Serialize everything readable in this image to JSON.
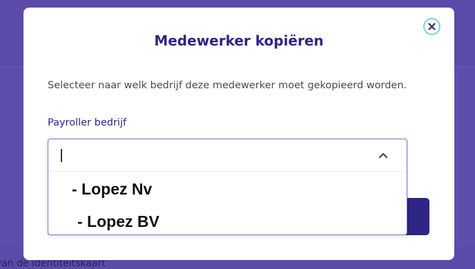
{
  "background": {
    "partial_text": "van de identiteitskaart"
  },
  "modal": {
    "title": "Medewerker kopiëren",
    "description": "Selecteer naar welk bedrijf deze medewerker moet gekopieerd worden.",
    "close_icon": "close-icon",
    "field": {
      "label": "Payroller bedrijf",
      "value": "",
      "chevron_icon": "chevron-up-icon",
      "options": [
        {
          "label": "- Lopez Nv"
        },
        {
          "label": " - Lopez BV"
        }
      ]
    }
  },
  "colors": {
    "overlay": "#5b4aa8",
    "title": "#2e2584",
    "close_ring": "#7fd3d6",
    "primary_button": "#2e2584",
    "select_border": "#7b72c4"
  }
}
